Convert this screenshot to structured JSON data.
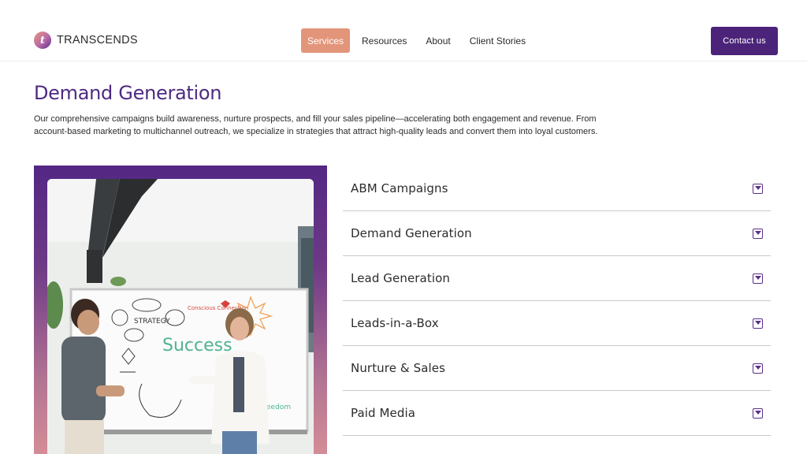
{
  "brand": {
    "name": "TRANSCENDS",
    "logo_glyph": "t",
    "colors": {
      "primary": "#4b2479",
      "accent": "#e3957a"
    }
  },
  "nav": {
    "items": [
      {
        "label": "Services",
        "active": true
      },
      {
        "label": "Resources",
        "active": false
      },
      {
        "label": "About",
        "active": false
      },
      {
        "label": "Client Stories",
        "active": false
      }
    ]
  },
  "header": {
    "contact_label": "Contact us"
  },
  "main": {
    "title": "Demand Generation",
    "intro": "Our comprehensive campaigns build awareness, nurture prospects, and fill your sales pipeline—accelerating both engagement and revenue. From account-based marketing to multichannel outreach, we specialize in strategies that attract high-quality leads and convert them into loyal customers.",
    "image": {
      "whiteboard": {
        "title_word": "Success",
        "words": [
          "STRATEGY",
          "Conscious Connection",
          "Freedom"
        ]
      }
    }
  },
  "accordion": {
    "items": [
      {
        "label": "ABM Campaigns",
        "icon": "chevron-down-icon"
      },
      {
        "label": "Demand Generation",
        "icon": "chevron-down-icon"
      },
      {
        "label": "Lead Generation",
        "icon": "chevron-down-icon"
      },
      {
        "label": "Leads-in-a-Box",
        "icon": "chevron-down-icon"
      },
      {
        "label": "Nurture & Sales",
        "icon": "chevron-down-icon"
      },
      {
        "label": "Paid Media",
        "icon": "chevron-down-icon"
      }
    ]
  }
}
